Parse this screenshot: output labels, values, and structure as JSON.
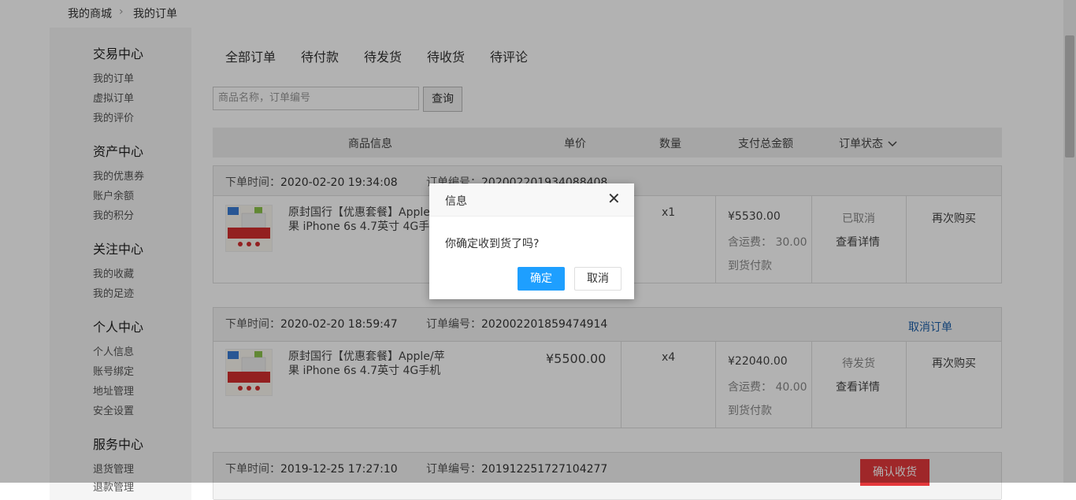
{
  "breadcrumb": {
    "home": "我的商城",
    "sep": "›",
    "current": "我的订单"
  },
  "sidebar": {
    "groups": [
      {
        "title": "交易中心",
        "items": [
          "我的订单",
          "虚拟订单",
          "我的评价"
        ]
      },
      {
        "title": "资产中心",
        "items": [
          "我的优惠券",
          "账户余额",
          "我的积分"
        ]
      },
      {
        "title": "关注中心",
        "items": [
          "我的收藏",
          "我的足迹"
        ]
      },
      {
        "title": "个人中心",
        "items": [
          "个人信息",
          "账号绑定",
          "地址管理",
          "安全设置"
        ]
      },
      {
        "title": "服务中心",
        "items": [
          "退货管理",
          "退款管理"
        ]
      }
    ]
  },
  "tabs": [
    "全部订单",
    "待付款",
    "待发货",
    "待收货",
    "待评论"
  ],
  "search": {
    "placeholder": "商品名称，订单编号",
    "button": "查询"
  },
  "table_headers": {
    "product": "商品信息",
    "price": "单价",
    "qty": "数量",
    "total": "支付总金额",
    "status": "订单状态",
    "status_icon": "chevron-down-icon"
  },
  "orders": [
    {
      "time_label": "下单时间：",
      "time": "2020-02-20 19:34:08",
      "no_label": "订单编号：",
      "no": "202002201934088408",
      "product_line1": "原封国行【优惠套餐】Apple/苹",
      "product_line2": "果 iPhone 6s 4.7英寸 4G手机",
      "price": "",
      "qty": "x1",
      "total": "¥5530.00",
      "shipping": "含运费： 30.00",
      "pay_method": "到货付款",
      "status": "已取消",
      "detail": "查看详情",
      "rebuy": "再次购买"
    },
    {
      "time_label": "下单时间：",
      "time": "2020-02-20 18:59:47",
      "no_label": "订单编号：",
      "no": "202002201859474914",
      "action": "取消订单",
      "product_line1": "原封国行【优惠套餐】Apple/苹",
      "product_line2": "果 iPhone 6s 4.7英寸 4G手机",
      "price": "¥5500.00",
      "qty": "x4",
      "total": "¥22040.00",
      "shipping": "含运费： 40.00",
      "pay_method": "到货付款",
      "status": "待发货",
      "detail": "查看详情",
      "rebuy": "再次购买"
    },
    {
      "time_label": "下单时间：",
      "time": "2019-12-25 17:27:10",
      "no_label": "订单编号：",
      "no": "201912251727104277",
      "action": "确认收货"
    }
  ],
  "thumb_text": {
    "top": "iPhone 6s",
    "mid": "4G手机",
    "big": "原封国行"
  },
  "dialog": {
    "title": "信息",
    "close": "✕",
    "message": "你确定收到货了吗?",
    "ok": "确定",
    "cancel": "取消"
  },
  "colors": {
    "primary": "#1e9fff",
    "danger": "#e4393c",
    "link": "#1a5ea8"
  }
}
